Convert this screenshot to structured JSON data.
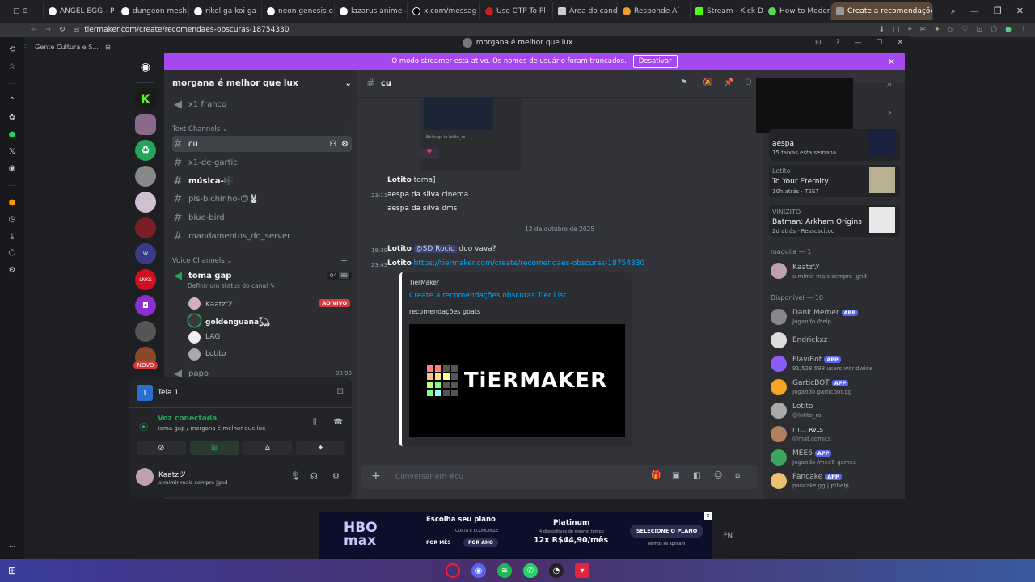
{
  "browser": {
    "tabs": [
      {
        "label": "ANGEL EGG - P"
      },
      {
        "label": "dungeon mesh"
      },
      {
        "label": "rikel ga koi ga"
      },
      {
        "label": "neon genesis e"
      },
      {
        "label": "lazarus anime -"
      },
      {
        "label": "x.com/messag"
      },
      {
        "label": "Use OTP To Pl"
      },
      {
        "label": "Área do candid"
      },
      {
        "label": "Responde Aí"
      },
      {
        "label": "Stream - Kick D"
      },
      {
        "label": "How to Modera"
      },
      {
        "label": "Create a recomendaçõe"
      }
    ],
    "url": "tiermaker.com/create/recomendaes-obscuras-18754330",
    "bookmark": "Gente Cultura e S..."
  },
  "discord": {
    "window_title": "morgana é melhor que lux",
    "streamer_banner": "O modo streamer está ativo. Os nomes de usuário foram truncados.",
    "streamer_button": "Desativar",
    "server_name": "morgana é melhor que lux",
    "new_badge": "NOVO",
    "channels": {
      "top_voice": "x1 franco",
      "text_category": "Text Channels",
      "text": [
        "cu",
        "x1-de-gartic",
        "música-🎼",
        "pls-bichinho-😊🐰",
        "blue-bird",
        "mandamentos_do_server"
      ],
      "voice_category": "Voice Channels",
      "voice_channel": "toma gap",
      "voice_status": "Definir um status do canal",
      "voice_count": "04",
      "voice_limit": "99",
      "voice_users": [
        "Kaatzツ",
        "goldenguana𓆏",
        "LAG",
        "Lotito"
      ],
      "live_badge": "AO VIVO",
      "cut_channel": "papo",
      "cut_count": "00",
      "cut_limit": "99"
    },
    "screen_share": "Tela 1",
    "voice_connected": "Voz conectada",
    "voice_location": "toma gap / morgana é melhor que lux",
    "self_user": {
      "name": "Kaatzツ",
      "status": "a mimir mais sempre jgnd"
    },
    "chat": {
      "channel": "cu",
      "image_caption": "Belongs to lotito_ro",
      "messages": [
        {
          "user": "Lotito",
          "text": "toma]"
        },
        {
          "time": "23:11",
          "user": "aespa da silva",
          "text": "cinema"
        },
        {
          "user": "aespa da silva",
          "text": "dms"
        }
      ],
      "date_divider": "12 de outubro de 2025",
      "messages2": [
        {
          "time": "18:39",
          "user": "Lotito",
          "mention": "@SD Rocio",
          "text": "duo vava?"
        },
        {
          "time": "23:43",
          "user": "Lotito",
          "link": "https://tiermaker.com/create/recomendaes-obscuras-18754330"
        }
      ],
      "embed": {
        "provider": "TierMaker",
        "title": "Create a recomendações obscuras Tier List",
        "description": "recomendações goats",
        "logo_text": "TiERMAKER"
      },
      "input_placeholder": "Conversar em #cu"
    },
    "activity_cards": [
      {
        "title": "aespa",
        "sub": "15 faixas esta semana"
      },
      {
        "user": "Lotito",
        "title": "To Your Eternity",
        "time": "10h atrás",
        "extra": "T2E7"
      },
      {
        "user": "VINIZITO",
        "title": "Batman: Arkham Origins",
        "time": "2d atrás",
        "extra": "Ressuscitou"
      }
    ],
    "member_groups": [
      {
        "label": "maguila — 1"
      },
      {
        "label": "Disponível — 10"
      }
    ],
    "members": [
      {
        "name": "Kaatzツ",
        "sub": "a mimir mais sempre jgnd",
        "app": false
      },
      {
        "name": "Dank Memer",
        "sub": "Jogando /help",
        "app": true
      },
      {
        "name": "Endrickxz",
        "sub": "",
        "app": false
      },
      {
        "name": "FlaviBot",
        "sub": "91,528,598 users worldwide",
        "app": true
      },
      {
        "name": "GarticBOT",
        "sub": "Jogando garticbot.gg",
        "app": true
      },
      {
        "name": "Lotito",
        "sub": "@lotito_ro",
        "app": false
      },
      {
        "name": "m...",
        "sub": "@mat.comics",
        "app": false,
        "tag": "RVLS"
      },
      {
        "name": "MEE6",
        "sub": "Jogando /mee6-games",
        "app": true
      },
      {
        "name": "Pancake",
        "sub": "pancake.gg | p!help",
        "app": true
      }
    ],
    "app_label": "APP"
  },
  "ad": {
    "brand": "HBO max",
    "heading": "Escolha seu plano",
    "sub": "CURTA E ECONOMIZE",
    "option1": "POR MÊS",
    "option2": "POR ANO",
    "plan": "Platinum",
    "plan_note": "4 dispositivos do mesmo tempo",
    "price": "12x R$44,90/mês",
    "cta": "SELECIONE O PLANO",
    "terms": "Termos se aplicam.",
    "pn": "PN"
  },
  "colors": {
    "accent": "#a548f0",
    "link": "#00a8fc",
    "live": "#da373c",
    "online": "#23a55a"
  }
}
